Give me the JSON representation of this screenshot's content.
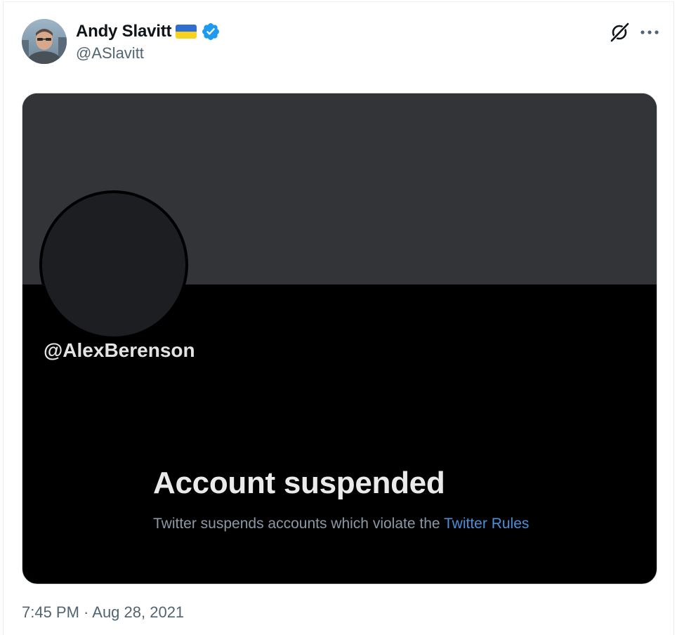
{
  "author": {
    "display_name": "Andy Slavitt",
    "handle": "@ASlavitt",
    "flag_icon": "ukraine-flag-icon",
    "verified_icon": "verified-badge-icon",
    "verified_color": "#1d9bf0"
  },
  "actions": {
    "grok_icon": "grok-icon",
    "more_icon": "more-options-icon"
  },
  "media": {
    "suspended_handle": "@AlexBerenson",
    "title": "Account suspended",
    "description_prefix": "Twitter suspends accounts which violate the ",
    "description_link": "Twitter Rules",
    "banner_color": "#333437",
    "link_color": "#4a8fd7"
  },
  "meta": {
    "timestamp": "7:45 PM · Aug 28, 2021"
  }
}
